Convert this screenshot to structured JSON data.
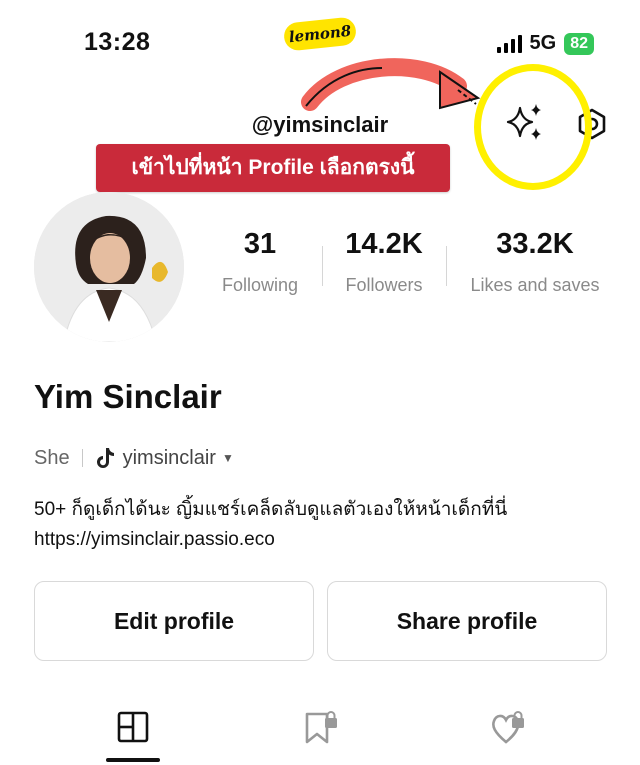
{
  "status_bar": {
    "time": "13:28",
    "network": "5G",
    "battery": "82"
  },
  "watermark": "lemon8",
  "header": {
    "username": "@yimsinclair",
    "sparkle_icon": "sparkle-icon",
    "settings_icon": "settings-icon"
  },
  "annotation": {
    "banner_text": "เข้าไปที่หน้า Profile เลือกตรงนี้",
    "highlight_color": "#fff000",
    "arrow_color": "#f0655c"
  },
  "stats": [
    {
      "value": "31",
      "label": "Following"
    },
    {
      "value": "14.2K",
      "label": "Followers"
    },
    {
      "value": "33.2K",
      "label": "Likes and saves"
    }
  ],
  "profile": {
    "name": "Yim Sinclair",
    "pronoun": "She",
    "tiktok_handle": "yimsinclair",
    "bio_line1": "50+ ก็ดูเด็กได้นะ ญิ้มแชร์เคล็ดลับดูแลตัวเองให้หน้าเด็กที่นี่",
    "bio_line2": "https://yimsinclair.passio.eco"
  },
  "actions": {
    "edit_label": "Edit profile",
    "share_label": "Share profile"
  },
  "tabs": [
    {
      "icon": "grid-layout-icon",
      "active": true
    },
    {
      "icon": "bookmark-lock-icon",
      "active": false
    },
    {
      "icon": "heart-lock-icon",
      "active": false
    }
  ],
  "colors": {
    "banner_bg": "#c92a3a",
    "battery": "#34c759",
    "logo_bg": "#ffe400"
  }
}
